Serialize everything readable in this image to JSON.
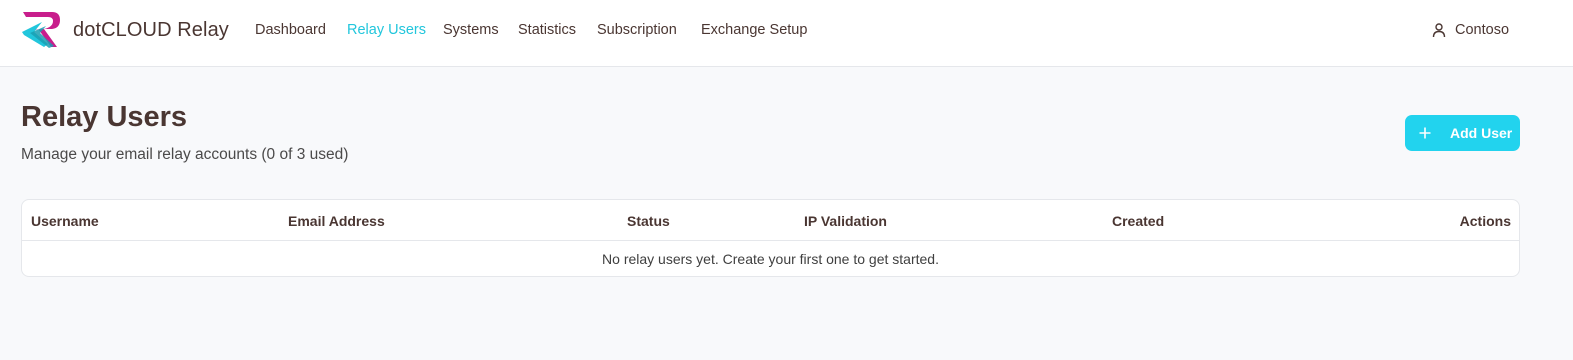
{
  "app": {
    "brand": "dotCLOUD Relay",
    "colors": {
      "accent": "#22d3ee",
      "text": "#4a3632",
      "logo_magenta": "#c81e8c",
      "logo_teal": "#22c6dc"
    }
  },
  "nav": {
    "items": [
      {
        "label": "Dashboard",
        "active": false
      },
      {
        "label": "Relay Users",
        "active": true
      },
      {
        "label": "Systems",
        "active": false
      },
      {
        "label": "Statistics",
        "active": false
      },
      {
        "label": "Subscription",
        "active": false
      },
      {
        "label": "Exchange Setup",
        "active": false
      }
    ]
  },
  "user": {
    "name": "Contoso",
    "icon": "user-icon"
  },
  "page": {
    "title": "Relay Users",
    "subtitle": "Manage your email relay accounts (0 of 3 used)",
    "add_button": {
      "label": "Add User",
      "icon": "plus-icon"
    }
  },
  "table": {
    "columns": [
      "Username",
      "Email Address",
      "Status",
      "IP Validation",
      "Created",
      "Actions"
    ],
    "empty_message": "No relay users yet. Create your first one to get started."
  }
}
